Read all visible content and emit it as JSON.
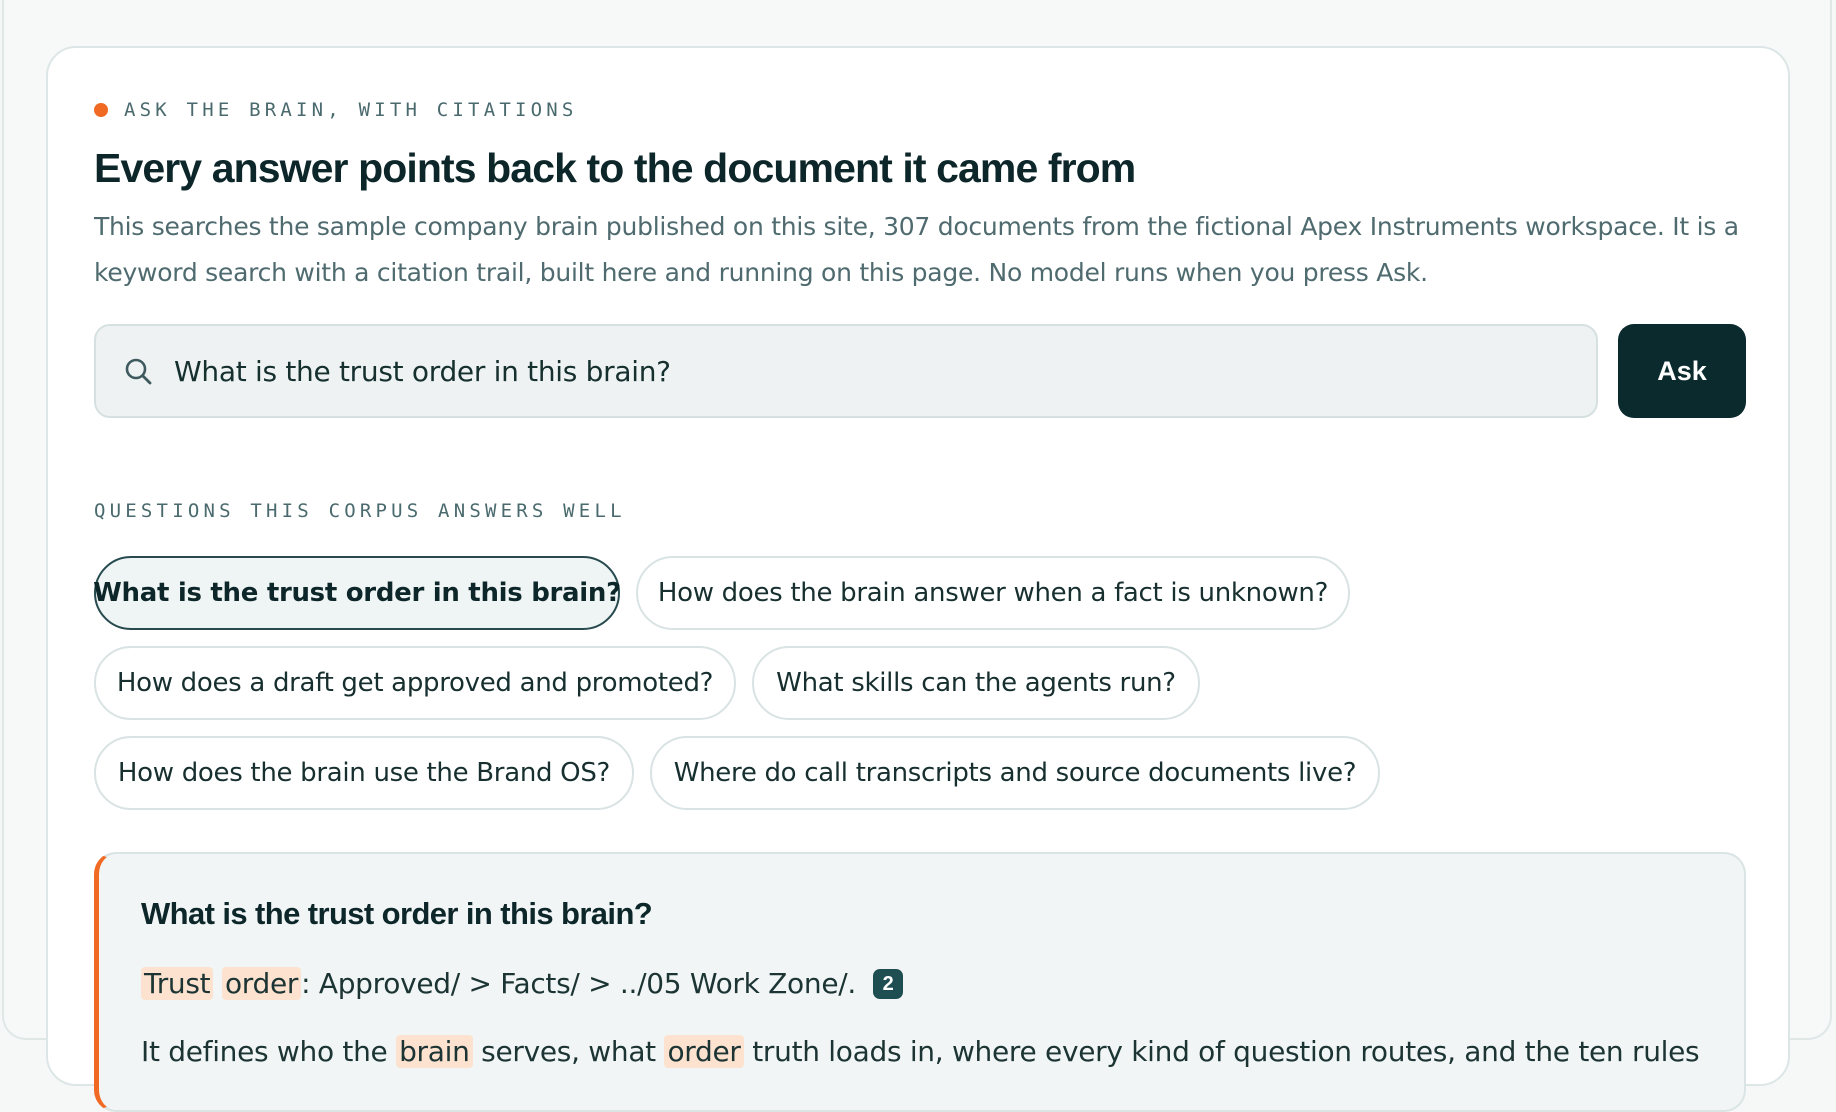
{
  "eyebrow": "ASK THE BRAIN, WITH CITATIONS",
  "headline": "Every answer points back to the document it came from",
  "lede": "This searches the sample company brain published on this site, 307 documents from the fictional Apex Instruments workspace. It is a keyword search with a citation trail, built here and running on this page. No model runs when you press Ask.",
  "search": {
    "value": "What is the trust order in this brain?",
    "icon": "search-icon"
  },
  "ask_label": "Ask",
  "suggestions_label": "QUESTIONS THIS CORPUS ANSWERS WELL",
  "suggestions": [
    "What is the trust order in this brain?",
    "How does the brain answer when a fact is unknown?",
    "How does a draft get approved and promoted?",
    "What skills can the agents run?",
    "How does the brain use the Brand OS?",
    "Where do call transcripts and source documents live?"
  ],
  "answer": {
    "question": "What is the trust order in this brain?",
    "line1": {
      "hl1": "Trust",
      "hl2": "order",
      "rest": ": Approved/ > Facts/ > ../05 Work Zone/.",
      "citation": "2"
    },
    "line2": {
      "t1": "It defines who the ",
      "hl1": "brain",
      "t2": " serves, what ",
      "hl2": "order",
      "t3": " truth loads in, where every kind of question routes, and the ten rules"
    }
  },
  "colors": {
    "accent": "#f06a24",
    "primary": "#0b2a2e",
    "highlight": "#fde2cf"
  }
}
